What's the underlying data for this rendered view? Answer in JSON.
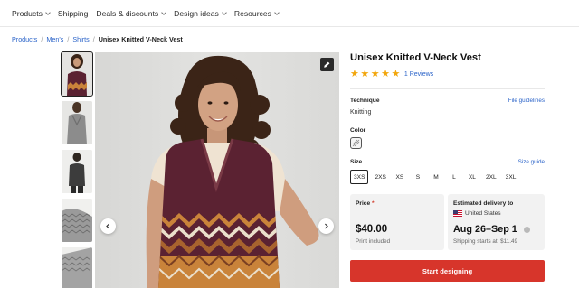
{
  "nav": {
    "items": [
      {
        "label": "Products",
        "dropdown": true
      },
      {
        "label": "Shipping",
        "dropdown": false
      },
      {
        "label": "Deals & discounts",
        "dropdown": true
      },
      {
        "label": "Design ideas",
        "dropdown": true
      },
      {
        "label": "Resources",
        "dropdown": true
      }
    ]
  },
  "breadcrumb": {
    "items": [
      "Products",
      "Men's",
      "Shirts"
    ],
    "separator": "/",
    "current": "Unisex Knitted V-Neck Vest"
  },
  "gallery": {
    "thumbnail_count": 5,
    "active_index": 0,
    "edit_icon": "pencil-icon",
    "prev_icon": "chevron-left-icon",
    "next_icon": "chevron-right-icon"
  },
  "product": {
    "title": "Unisex Knitted V-Neck Vest",
    "rating": 5,
    "reviews_label": "1 Reviews",
    "technique": {
      "label": "Technique",
      "value": "Knitting",
      "link": "File guidelines"
    },
    "color": {
      "label": "Color"
    },
    "size": {
      "label": "Size",
      "link": "Size guide",
      "options": [
        "3XS",
        "2XS",
        "XS",
        "S",
        "M",
        "L",
        "XL",
        "2XL",
        "3XL"
      ],
      "selected": "3XS"
    },
    "price_card": {
      "label": "Price",
      "required_mark": "*",
      "price": "$40.00",
      "note": "Print included"
    },
    "delivery_card": {
      "label": "Estimated delivery to",
      "country": "United States",
      "dates": "Aug 26–Sep 1",
      "shipping": "Shipping starts at: $11.49"
    },
    "cta_label": "Start designing"
  },
  "colors": {
    "accent_blue": "#2a63c9",
    "star": "#f2a60c",
    "cta_red": "#d7352b",
    "vest_maroon": "#5b2232",
    "vest_gold": "#c9833a"
  }
}
